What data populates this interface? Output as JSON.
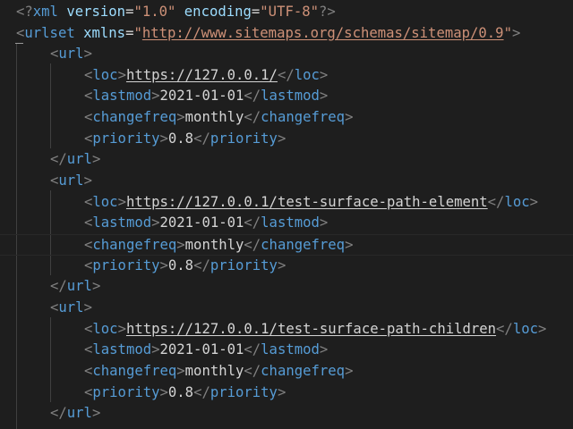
{
  "xml_declaration": {
    "open": "<?",
    "name": "xml",
    "version_attr": "version",
    "eq": "=",
    "version_value": "\"1.0\"",
    "encoding_attr": "encoding",
    "encoding_value": "\"UTF-8\"",
    "close": "?>"
  },
  "urlset": {
    "tag": "urlset",
    "xmlns_attr": "xmlns",
    "eq": "=",
    "xmlns_value_url": "http://www.sitemaps.org/schemas/sitemap/0.9",
    "quote": "\""
  },
  "punct": {
    "lt": "<",
    "gt": ">",
    "lt_slash": "</"
  },
  "tags": {
    "url": "url",
    "loc": "loc",
    "lastmod": "lastmod",
    "changefreq": "changefreq",
    "priority": "priority"
  },
  "urls": [
    {
      "loc": "https://127.0.0.1/",
      "lastmod": "2021-01-01",
      "changefreq": "monthly",
      "priority": "0.8"
    },
    {
      "loc": "https://127.0.0.1/test-surface-path-element",
      "lastmod": "2021-01-01",
      "changefreq": "monthly",
      "priority": "0.8"
    },
    {
      "loc": "https://127.0.0.1/test-surface-path-children",
      "lastmod": "2021-01-01",
      "changefreq": "monthly",
      "priority": "0.8"
    }
  ],
  "theme": {
    "background": "#1e1e1e",
    "punctuation": "#808080",
    "tag": "#569cd6",
    "attribute": "#9cdcfe",
    "string": "#ce9178",
    "text": "#d4d4d4"
  }
}
